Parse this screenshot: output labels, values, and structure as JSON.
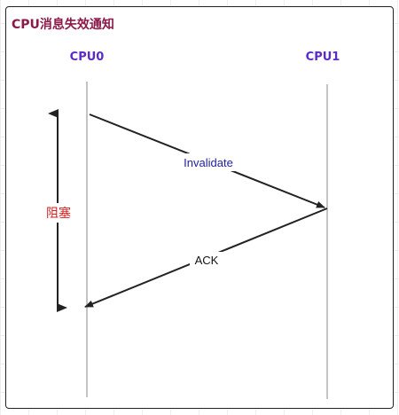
{
  "title": "CPU消息失效通知",
  "actors": [
    "CPU0",
    "CPU1"
  ],
  "messages": [
    {
      "label": "Invalidate",
      "from": "CPU0",
      "to": "CPU1"
    },
    {
      "label": "ACK",
      "from": "CPU1",
      "to": "CPU0"
    }
  ],
  "blocking_label": "阻塞",
  "colors": {
    "title": "#8b1a4a",
    "actor": "#5b2bc4",
    "invalidate_label": "#1e1ea0",
    "ack_label": "#111111",
    "blocking_label": "#d42020",
    "lifeline": "#b0b0b0",
    "arrow": "#222222"
  }
}
